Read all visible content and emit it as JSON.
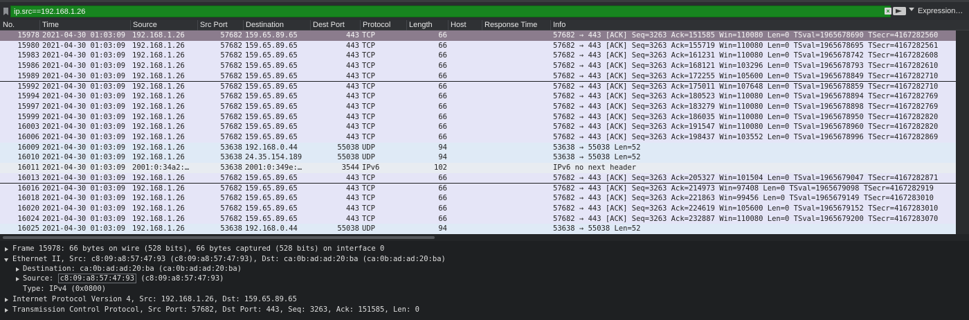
{
  "filter": {
    "value": "ip.src==192.168.1.26",
    "expression_label": "Expression…"
  },
  "columns": [
    "No.",
    "Time",
    "Source",
    "Src Port",
    "Destination",
    "Dest Port",
    "Protocol",
    "Length",
    "Host",
    "Response Time",
    "Info"
  ],
  "packets": [
    {
      "no": "15978",
      "time": "2021-04-30 01:03:09",
      "src": "192.168.1.26",
      "sport": "57682",
      "dst": "159.65.89.65",
      "dport": "443",
      "proto": "TCP",
      "len": "66",
      "info": "57682 → 443 [ACK] Seq=3263 Ack=151585 Win=110080 Len=0 TSval=1965678690 TSecr=4167282560",
      "selected": true
    },
    {
      "no": "15980",
      "time": "2021-04-30 01:03:09",
      "src": "192.168.1.26",
      "sport": "57682",
      "dst": "159.65.89.65",
      "dport": "443",
      "proto": "TCP",
      "len": "66",
      "info": "57682 → 443 [ACK] Seq=3263 Ack=155719 Win=110080 Len=0 TSval=1965678695 TSecr=4167282561"
    },
    {
      "no": "15983",
      "time": "2021-04-30 01:03:09",
      "src": "192.168.1.26",
      "sport": "57682",
      "dst": "159.65.89.65",
      "dport": "443",
      "proto": "TCP",
      "len": "66",
      "info": "57682 → 443 [ACK] Seq=3263 Ack=161231 Win=110080 Len=0 TSval=1965678742 TSecr=4167282608"
    },
    {
      "no": "15986",
      "time": "2021-04-30 01:03:09",
      "src": "192.168.1.26",
      "sport": "57682",
      "dst": "159.65.89.65",
      "dport": "443",
      "proto": "TCP",
      "len": "66",
      "info": "57682 → 443 [ACK] Seq=3263 Ack=168121 Win=103296 Len=0 TSval=1965678793 TSecr=4167282610"
    },
    {
      "no": "15989",
      "time": "2021-04-30 01:03:09",
      "src": "192.168.1.26",
      "sport": "57682",
      "dst": "159.65.89.65",
      "dport": "443",
      "proto": "TCP",
      "len": "66",
      "info": "57682 → 443 [ACK] Seq=3263 Ack=172255 Win=105600 Len=0 TSval=1965678849 TSecr=4167282710"
    },
    {
      "no": "15992",
      "time": "2021-04-30 01:03:09",
      "src": "192.168.1.26",
      "sport": "57682",
      "dst": "159.65.89.65",
      "dport": "443",
      "proto": "TCP",
      "len": "66",
      "info": "57682 → 443 [ACK] Seq=3263 Ack=175011 Win=107648 Len=0 TSval=1965678859 TSecr=4167282710"
    },
    {
      "no": "15994",
      "time": "2021-04-30 01:03:09",
      "src": "192.168.1.26",
      "sport": "57682",
      "dst": "159.65.89.65",
      "dport": "443",
      "proto": "TCP",
      "len": "66",
      "info": "57682 → 443 [ACK] Seq=3263 Ack=180523 Win=110080 Len=0 TSval=1965678894 TSecr=4167282769"
    },
    {
      "no": "15997",
      "time": "2021-04-30 01:03:09",
      "src": "192.168.1.26",
      "sport": "57682",
      "dst": "159.65.89.65",
      "dport": "443",
      "proto": "TCP",
      "len": "66",
      "info": "57682 → 443 [ACK] Seq=3263 Ack=183279 Win=110080 Len=0 TSval=1965678898 TSecr=4167282769"
    },
    {
      "no": "15999",
      "time": "2021-04-30 01:03:09",
      "src": "192.168.1.26",
      "sport": "57682",
      "dst": "159.65.89.65",
      "dport": "443",
      "proto": "TCP",
      "len": "66",
      "info": "57682 → 443 [ACK] Seq=3263 Ack=186035 Win=110080 Len=0 TSval=1965678950 TSecr=4167282820"
    },
    {
      "no": "16003",
      "time": "2021-04-30 01:03:09",
      "src": "192.168.1.26",
      "sport": "57682",
      "dst": "159.65.89.65",
      "dport": "443",
      "proto": "TCP",
      "len": "66",
      "info": "57682 → 443 [ACK] Seq=3263 Ack=191547 Win=110080 Len=0 TSval=1965678960 TSecr=4167282820"
    },
    {
      "no": "16006",
      "time": "2021-04-30 01:03:09",
      "src": "192.168.1.26",
      "sport": "57682",
      "dst": "159.65.89.65",
      "dport": "443",
      "proto": "TCP",
      "len": "66",
      "info": "57682 → 443 [ACK] Seq=3263 Ack=198437 Win=103552 Len=0 TSval=1965678996 TSecr=4167282869"
    },
    {
      "no": "16009",
      "time": "2021-04-30 01:03:09",
      "src": "192.168.1.26",
      "sport": "53638",
      "dst": "192.168.0.44",
      "dport": "55038",
      "proto": "UDP",
      "len": "94",
      "info": "53638 → 55038 Len=52"
    },
    {
      "no": "16010",
      "time": "2021-04-30 01:03:09",
      "src": "192.168.1.26",
      "sport": "53638",
      "dst": "24.35.154.189",
      "dport": "55038",
      "proto": "UDP",
      "len": "94",
      "info": "53638 → 55038 Len=52"
    },
    {
      "no": "16011",
      "time": "2021-04-30 01:03:09",
      "src": "2001:0:34a2:…",
      "sport": "53638",
      "dst": "2001:0:349e:…",
      "dport": "3544",
      "proto": "IPv6",
      "len": "102",
      "info": "IPv6 no next header"
    },
    {
      "no": "16013",
      "time": "2021-04-30 01:03:09",
      "src": "192.168.1.26",
      "sport": "57682",
      "dst": "159.65.89.65",
      "dport": "443",
      "proto": "TCP",
      "len": "66",
      "info": "57682 → 443 [ACK] Seq=3263 Ack=205327 Win=101504 Len=0 TSval=1965679047 TSecr=4167282871"
    },
    {
      "no": "16016",
      "time": "2021-04-30 01:03:09",
      "src": "192.168.1.26",
      "sport": "57682",
      "dst": "159.65.89.65",
      "dport": "443",
      "proto": "TCP",
      "len": "66",
      "info": "57682 → 443 [ACK] Seq=3263 Ack=214973 Win=97408 Len=0 TSval=1965679098 TSecr=4167282919"
    },
    {
      "no": "16018",
      "time": "2021-04-30 01:03:09",
      "src": "192.168.1.26",
      "sport": "57682",
      "dst": "159.65.89.65",
      "dport": "443",
      "proto": "TCP",
      "len": "66",
      "info": "57682 → 443 [ACK] Seq=3263 Ack=221863 Win=99456 Len=0 TSval=1965679149 TSecr=4167283010"
    },
    {
      "no": "16020",
      "time": "2021-04-30 01:03:09",
      "src": "192.168.1.26",
      "sport": "57682",
      "dst": "159.65.89.65",
      "dport": "443",
      "proto": "TCP",
      "len": "66",
      "info": "57682 → 443 [ACK] Seq=3263 Ack=224619 Win=105600 Len=0 TSval=1965679152 TSecr=4167283010"
    },
    {
      "no": "16024",
      "time": "2021-04-30 01:03:09",
      "src": "192.168.1.26",
      "sport": "57682",
      "dst": "159.65.89.65",
      "dport": "443",
      "proto": "TCP",
      "len": "66",
      "info": "57682 → 443 [ACK] Seq=3263 Ack=232887 Win=110080 Len=0 TSval=1965679200 TSecr=4167283070"
    },
    {
      "no": "16025",
      "time": "2021-04-30 01:03:09",
      "src": "192.168.1.26",
      "sport": "53638",
      "dst": "192.168.0.44",
      "dport": "55038",
      "proto": "UDP",
      "len": "94",
      "info": "53638 → 55038 Len=52"
    }
  ],
  "details": {
    "frame": "Frame 15978: 66 bytes on wire (528 bits), 66 bytes captured (528 bits) on interface 0",
    "ethernet": "Ethernet II, Src: c8:09:a8:57:47:93 (c8:09:a8:57:47:93), Dst: ca:0b:ad:ad:20:ba (ca:0b:ad:ad:20:ba)",
    "eth_dst": "Destination: ca:0b:ad:ad:20:ba (ca:0b:ad:ad:20:ba)",
    "eth_src_label": "Source: ",
    "eth_src_value": "c8:09:a8:57:47:93",
    "eth_src_rest": " (c8:09:a8:57:47:93)",
    "eth_type": "Type: IPv4 (0x0800)",
    "ip": "Internet Protocol Version 4, Src: 192.168.1.26, Dst: 159.65.89.65",
    "tcp": "Transmission Control Protocol, Src Port: 57682, Dst Port: 443, Seq: 3263, Ack: 151585, Len: 0"
  },
  "colors": {
    "filter_valid": "#17841f",
    "selected_row": "#8b7c8d",
    "tcp_row": "#e5e5f7",
    "udp_row": "#dfeaf6"
  }
}
